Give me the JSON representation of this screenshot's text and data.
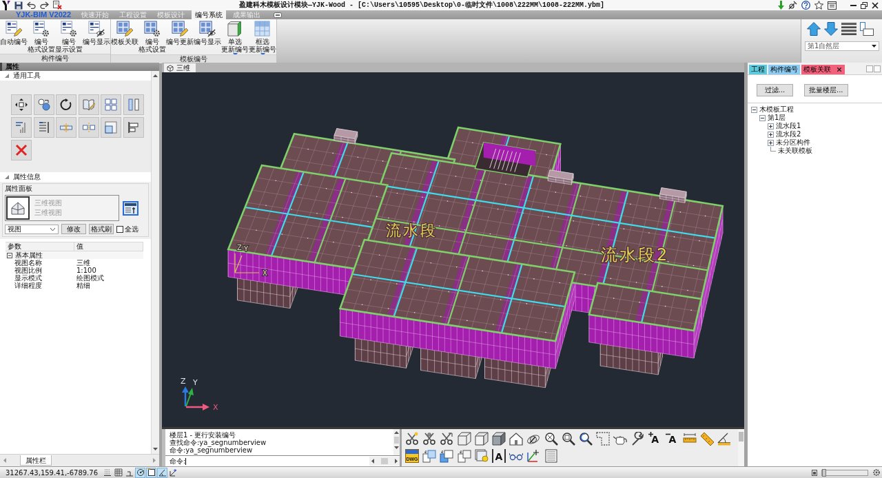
{
  "title_bar": {
    "title": "盈建科木模板设计模块—YJK-Wood - [C:\\Users\\10595\\Desktop\\0-临时文件\\1008\\222MM\\1008-222MM.ybm]"
  },
  "ribbon": {
    "app_button": "YJK-BIM V2022",
    "tabs": [
      {
        "label": "快速开始",
        "selected": false
      },
      {
        "label": "工程设置",
        "selected": false
      },
      {
        "label": "模板设计",
        "selected": false
      },
      {
        "label": "编号系统",
        "selected": true
      },
      {
        "label": "成果输出",
        "selected": false
      }
    ],
    "groups": [
      {
        "label": "构件编号",
        "buttons": [
          {
            "lines": [
              "自动编号"
            ],
            "has_menu": false
          },
          {
            "lines": [
              "编号",
              "格式设置"
            ],
            "has_menu": false
          },
          {
            "lines": [
              "编号",
              "显示设置"
            ],
            "has_menu": false
          },
          {
            "lines": [
              "编号显示"
            ],
            "has_menu": false
          }
        ]
      },
      {
        "label": "模板编号",
        "buttons": [
          {
            "lines": [
              "模板关联"
            ],
            "has_menu": false
          },
          {
            "lines": [
              "编号",
              "格式设置"
            ],
            "has_menu": false
          },
          {
            "lines": [
              "编号更新"
            ],
            "has_menu": false
          },
          {
            "lines": [
              "编号显示"
            ],
            "has_menu": false
          },
          {
            "lines": [
              "单选",
              "更新编号"
            ],
            "has_menu": true
          },
          {
            "lines": [
              "框选",
              "更新编号"
            ],
            "has_menu": true
          }
        ]
      }
    ],
    "floor_select": {
      "value": "第1自然层"
    }
  },
  "properties_panel": {
    "title": "属性",
    "sections": [
      {
        "label": "通用工具",
        "expanded": true
      },
      {
        "label": "属性信息",
        "expanded": true
      }
    ],
    "group_title": "属性面板",
    "preview": {
      "type": "三维视图",
      "name": "三维视图"
    },
    "type_select": {
      "value": "视图"
    },
    "buttons": [
      "修改",
      "格式刷"
    ],
    "select_all": {
      "label": "全选",
      "checked": false
    },
    "table": {
      "columns": [
        "参数",
        "值"
      ],
      "groups": [
        {
          "label": "基本属性",
          "expanded": true,
          "rows": [
            {
              "name": "视图名称",
              "value": "三维"
            },
            {
              "name": "视图比例",
              "value": "1:100"
            },
            {
              "name": "显示模式",
              "value": "绘图模式"
            },
            {
              "name": "详细程度",
              "value": "精细"
            }
          ]
        }
      ]
    },
    "bottom_tab": "属性栏"
  },
  "viewport": {
    "tab": "三维",
    "zone_labels": [
      "流水段",
      "流水段2"
    ],
    "model_axis_labels": [
      "Z",
      "Y",
      "X"
    ],
    "ucs_axis_labels": [
      "Z",
      "Y",
      "X"
    ]
  },
  "command_line": {
    "history": [
      "楼层1 - 更行安装编号",
      "查找命令:ya_segnumberview",
      "命令:ya_segnumberview"
    ],
    "prompt": "命令:"
  },
  "tool_palette": {
    "text_tool_glyphs": [
      "A",
      "A",
      "A"
    ],
    "export_badge": "DWG"
  },
  "right_panel": {
    "tabs": [
      {
        "label": "工程",
        "selected": false,
        "color": "#5ccadc"
      },
      {
        "label": "构件编号",
        "selected": false,
        "color": "#8ccbf2"
      },
      {
        "label": "模板关联",
        "selected": true,
        "color": "#f2607c"
      }
    ],
    "buttons": [
      "过滤...",
      "批量楼层..."
    ],
    "tree": [
      {
        "label": "木模板工程",
        "kind": "folder",
        "expanded": true,
        "children": [
          {
            "label": "第1层",
            "kind": "folder",
            "expanded": true,
            "children": [
              {
                "label": "流水段1",
                "kind": "folder",
                "expanded": false
              },
              {
                "label": "流水段2",
                "kind": "folder",
                "expanded": false
              },
              {
                "label": "未分区构件",
                "kind": "folder",
                "expanded": false
              },
              {
                "label": "未关联模板",
                "kind": "item"
              }
            ]
          }
        ]
      }
    ]
  },
  "status_bar": {
    "coordinates": "31267.43,159.41,-6789.76",
    "toggles": [
      {
        "on": false
      },
      {
        "on": false
      },
      {
        "on": false
      },
      {
        "on": true
      },
      {
        "on": true
      },
      {
        "on": true
      },
      {
        "on": false
      }
    ],
    "zoom_slider": {
      "level": 0
    }
  }
}
